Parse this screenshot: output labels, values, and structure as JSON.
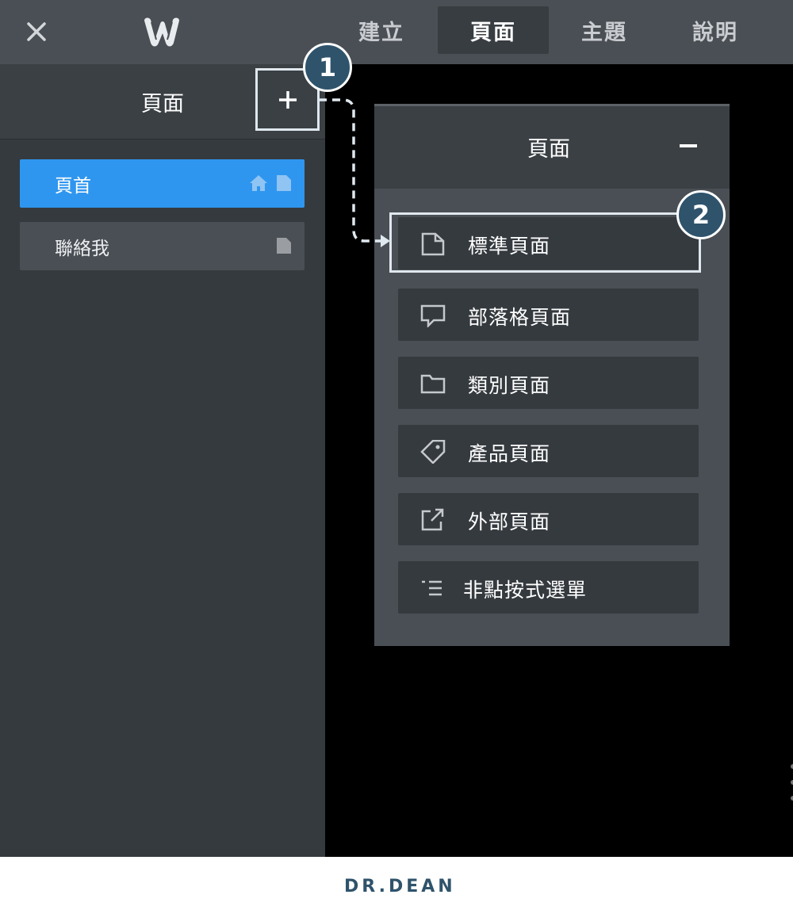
{
  "topbar": {
    "tabs": [
      {
        "label": "建立"
      },
      {
        "label": "頁面"
      },
      {
        "label": "主題"
      },
      {
        "label": "說明"
      }
    ],
    "active_tab": "頁面",
    "icons": [
      "close-icon",
      "weebly-logo-icon"
    ]
  },
  "sidebar": {
    "title": "頁面",
    "add_button_icon": "plus-icon",
    "pages": [
      {
        "label": "頁首",
        "active": true,
        "icons": [
          "home-icon",
          "page-icon"
        ]
      },
      {
        "label": "聯絡我",
        "active": false,
        "icons": [
          "page-icon"
        ]
      }
    ]
  },
  "popup": {
    "title": "頁面",
    "collapse_icon": "minus-icon",
    "items": [
      {
        "label": "標準頁面",
        "icon": "standard-page-icon"
      },
      {
        "label": "部落格頁面",
        "icon": "blog-page-icon"
      },
      {
        "label": "類別頁面",
        "icon": "folder-icon"
      },
      {
        "label": "產品頁面",
        "icon": "tag-icon"
      },
      {
        "label": "外部頁面",
        "icon": "external-link-icon"
      },
      {
        "label": "非點按式選單",
        "icon": "menu-list-icon"
      }
    ]
  },
  "annotations": {
    "step1": "1",
    "step2": "2"
  },
  "footer": {
    "brand": "DR.DEAN"
  },
  "colors": {
    "topbar": "#4a4f55",
    "sidebar": "#353a3f",
    "active_page": "#2f96ef",
    "badge": "#2f536b",
    "canvas": "#000000"
  }
}
